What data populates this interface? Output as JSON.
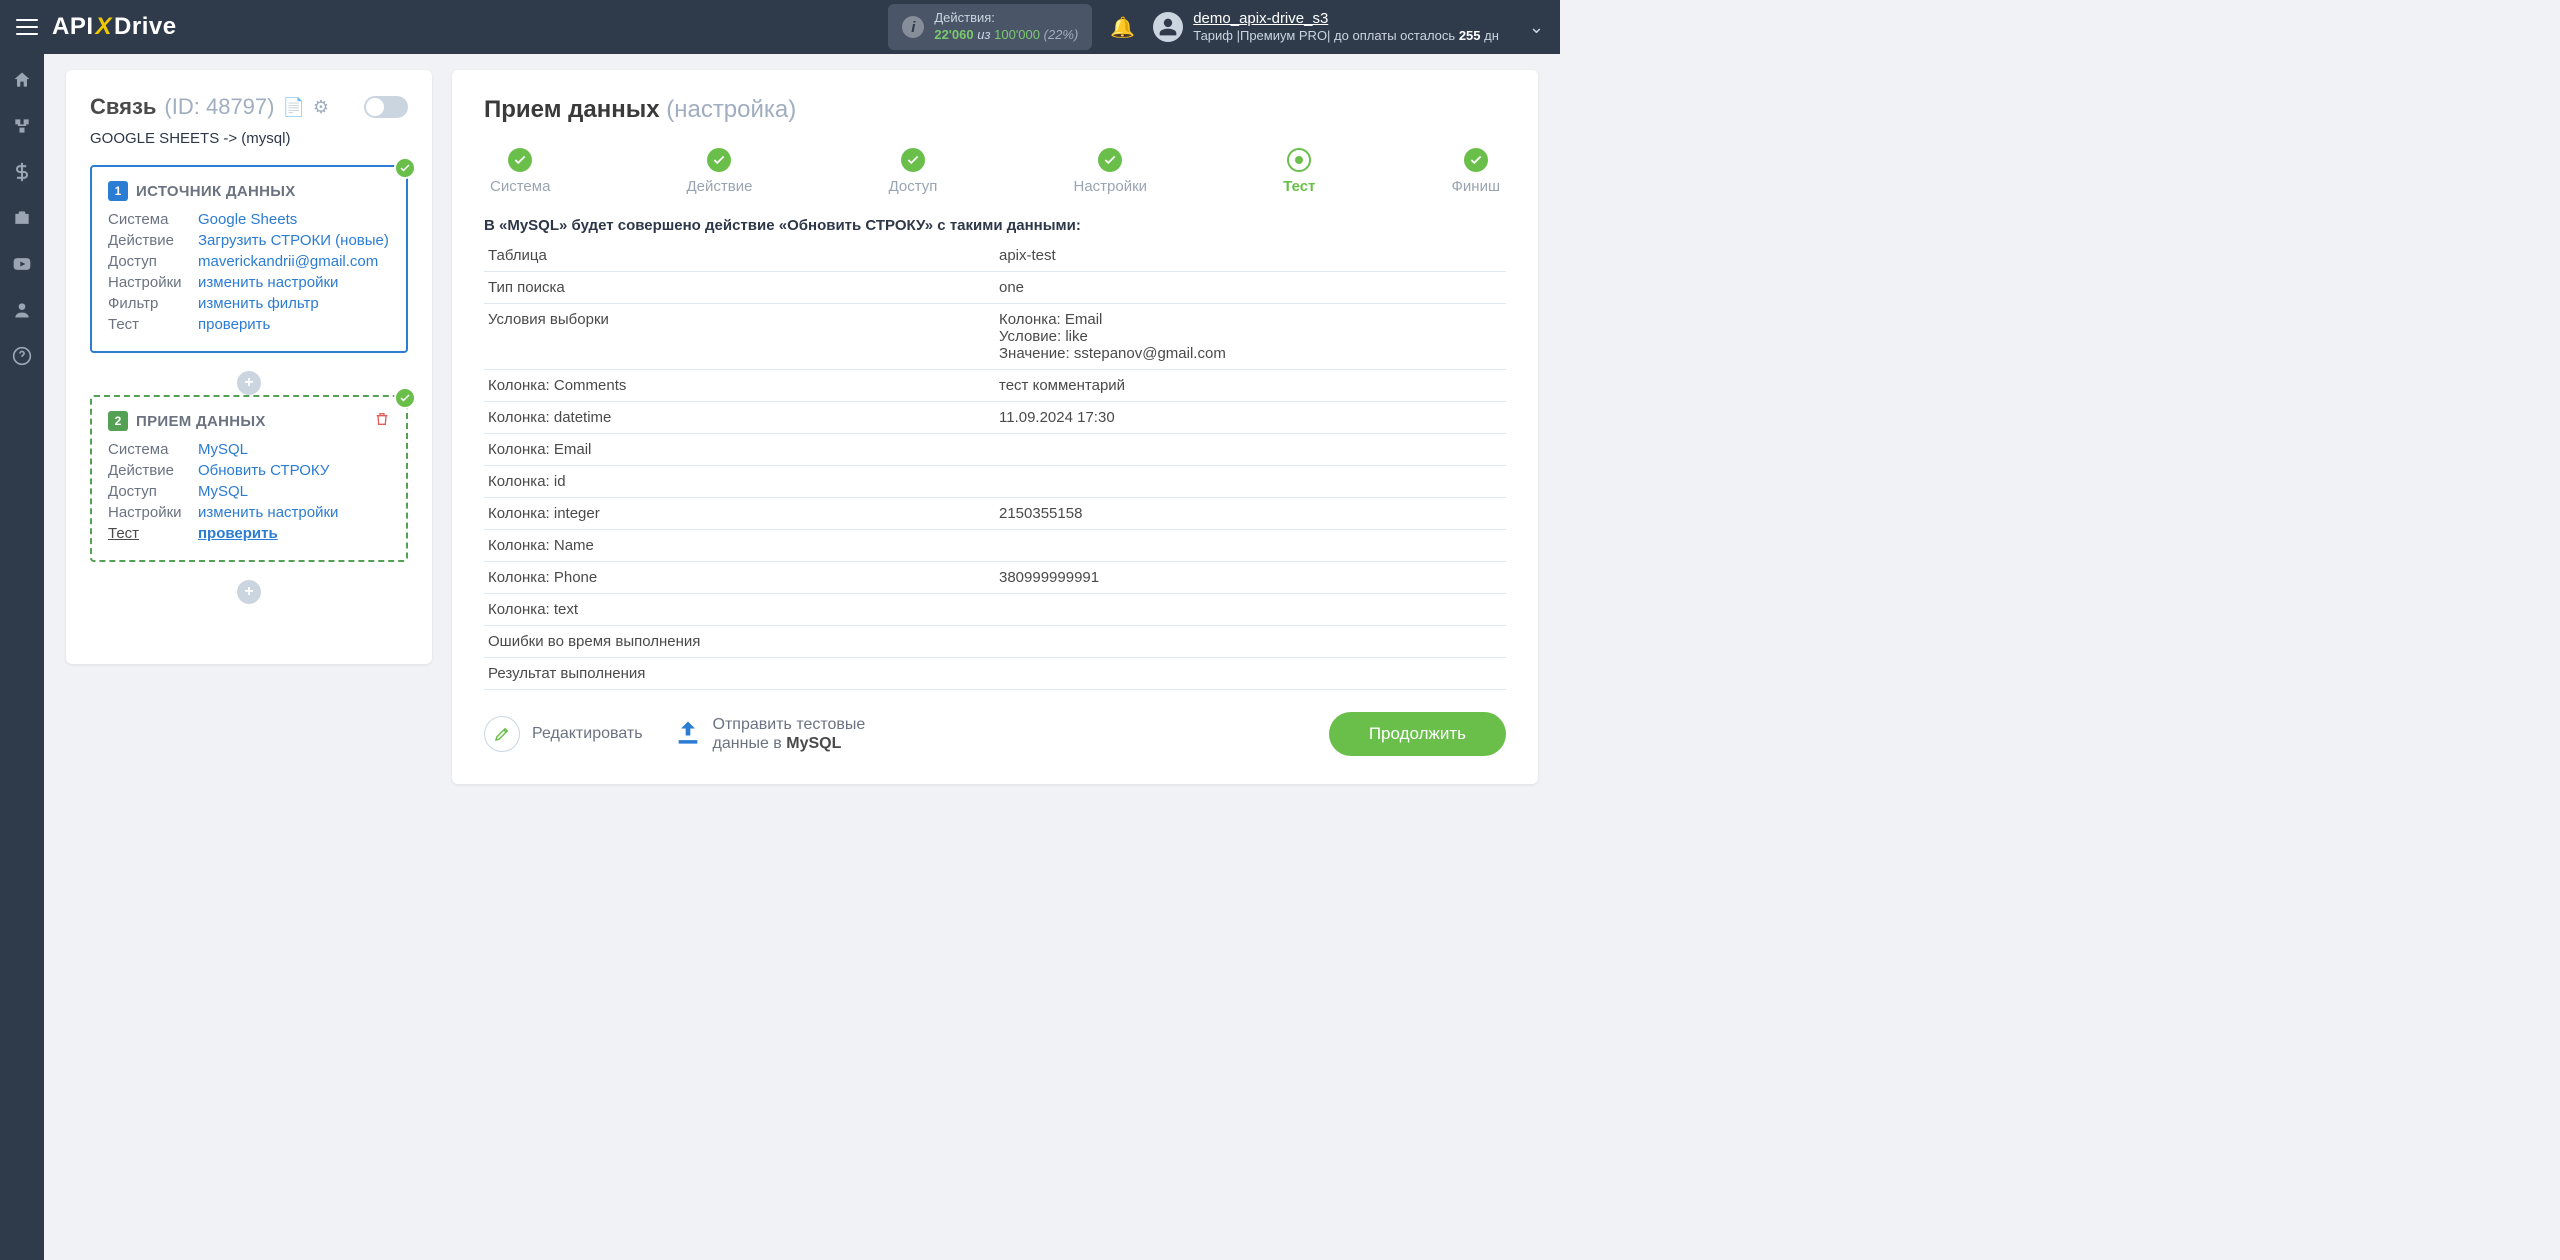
{
  "top": {
    "logo_pre": "API",
    "logo_post": "Drive",
    "actions_label": "Действия:",
    "actions_used": "22'060",
    "actions_of": "из",
    "actions_total": "100'000",
    "actions_pct": "(22%)",
    "user_name": "demo_apix-drive_s3",
    "tariff_prefix": "Тариф |Премиум PRO| до оплаты осталось ",
    "days_left": "255",
    "days_suffix": " дн"
  },
  "link": {
    "title": "Связь",
    "id_label": "(ID: 48797)",
    "flow": "GOOGLE SHEETS -> (mysql)",
    "block1": {
      "num": "1",
      "title": "ИСТОЧНИК ДАННЫХ",
      "rows": {
        "system_k": "Система",
        "system_v": "Google Sheets",
        "action_k": "Действие",
        "action_v": "Загрузить СТРОКИ (новые)",
        "access_k": "Доступ",
        "access_v": "maverickandrii@gmail.com",
        "settings_k": "Настройки",
        "settings_v": "изменить настройки",
        "filter_k": "Фильтр",
        "filter_v": "изменить фильтр",
        "test_k": "Тест",
        "test_v": "проверить"
      }
    },
    "block2": {
      "num": "2",
      "title": "ПРИЕМ ДАННЫХ",
      "rows": {
        "system_k": "Система",
        "system_v": "MySQL",
        "action_k": "Действие",
        "action_v": "Обновить СТРОКУ",
        "access_k": "Доступ",
        "access_v": "MySQL",
        "settings_k": "Настройки",
        "settings_v": "изменить настройки",
        "test_k": "Тест",
        "test_v": "проверить"
      }
    }
  },
  "main": {
    "title": "Прием данных",
    "subtitle": "(настройка)",
    "steps": {
      "s1": "Система",
      "s2": "Действие",
      "s3": "Доступ",
      "s4": "Настройки",
      "s5": "Тест",
      "s6": "Финиш"
    },
    "summary": "В «MySQL» будет совершено действие «Обновить СТРОКУ» с такими данными:",
    "rows": [
      {
        "k": "Таблица",
        "v": "apix-test"
      },
      {
        "k": "Тип поиска",
        "v": "one"
      },
      {
        "k": "Условия выборки",
        "v": "Колонка: Email\nУсловие: like\nЗначение: sstepanov@gmail.com"
      },
      {
        "k": "Колонка: Comments",
        "v": "тест комментарий"
      },
      {
        "k": "Колонка: datetime",
        "v": "11.09.2024 17:30"
      },
      {
        "k": "Колонка: Email",
        "v": ""
      },
      {
        "k": "Колонка: id",
        "v": ""
      },
      {
        "k": "Колонка: integer",
        "v": "2150355158"
      },
      {
        "k": "Колонка: Name",
        "v": ""
      },
      {
        "k": "Колонка: Phone",
        "v": "380999999991"
      },
      {
        "k": "Колонка: text",
        "v": ""
      },
      {
        "k": "Ошибки во время выполнения",
        "v": ""
      },
      {
        "k": "Результат выполнения",
        "v": ""
      }
    ],
    "edit_label": "Редактировать",
    "send_label_1": "Отправить тестовые",
    "send_label_2a": "данные в ",
    "send_label_2b": "MySQL",
    "continue": "Продолжить"
  }
}
